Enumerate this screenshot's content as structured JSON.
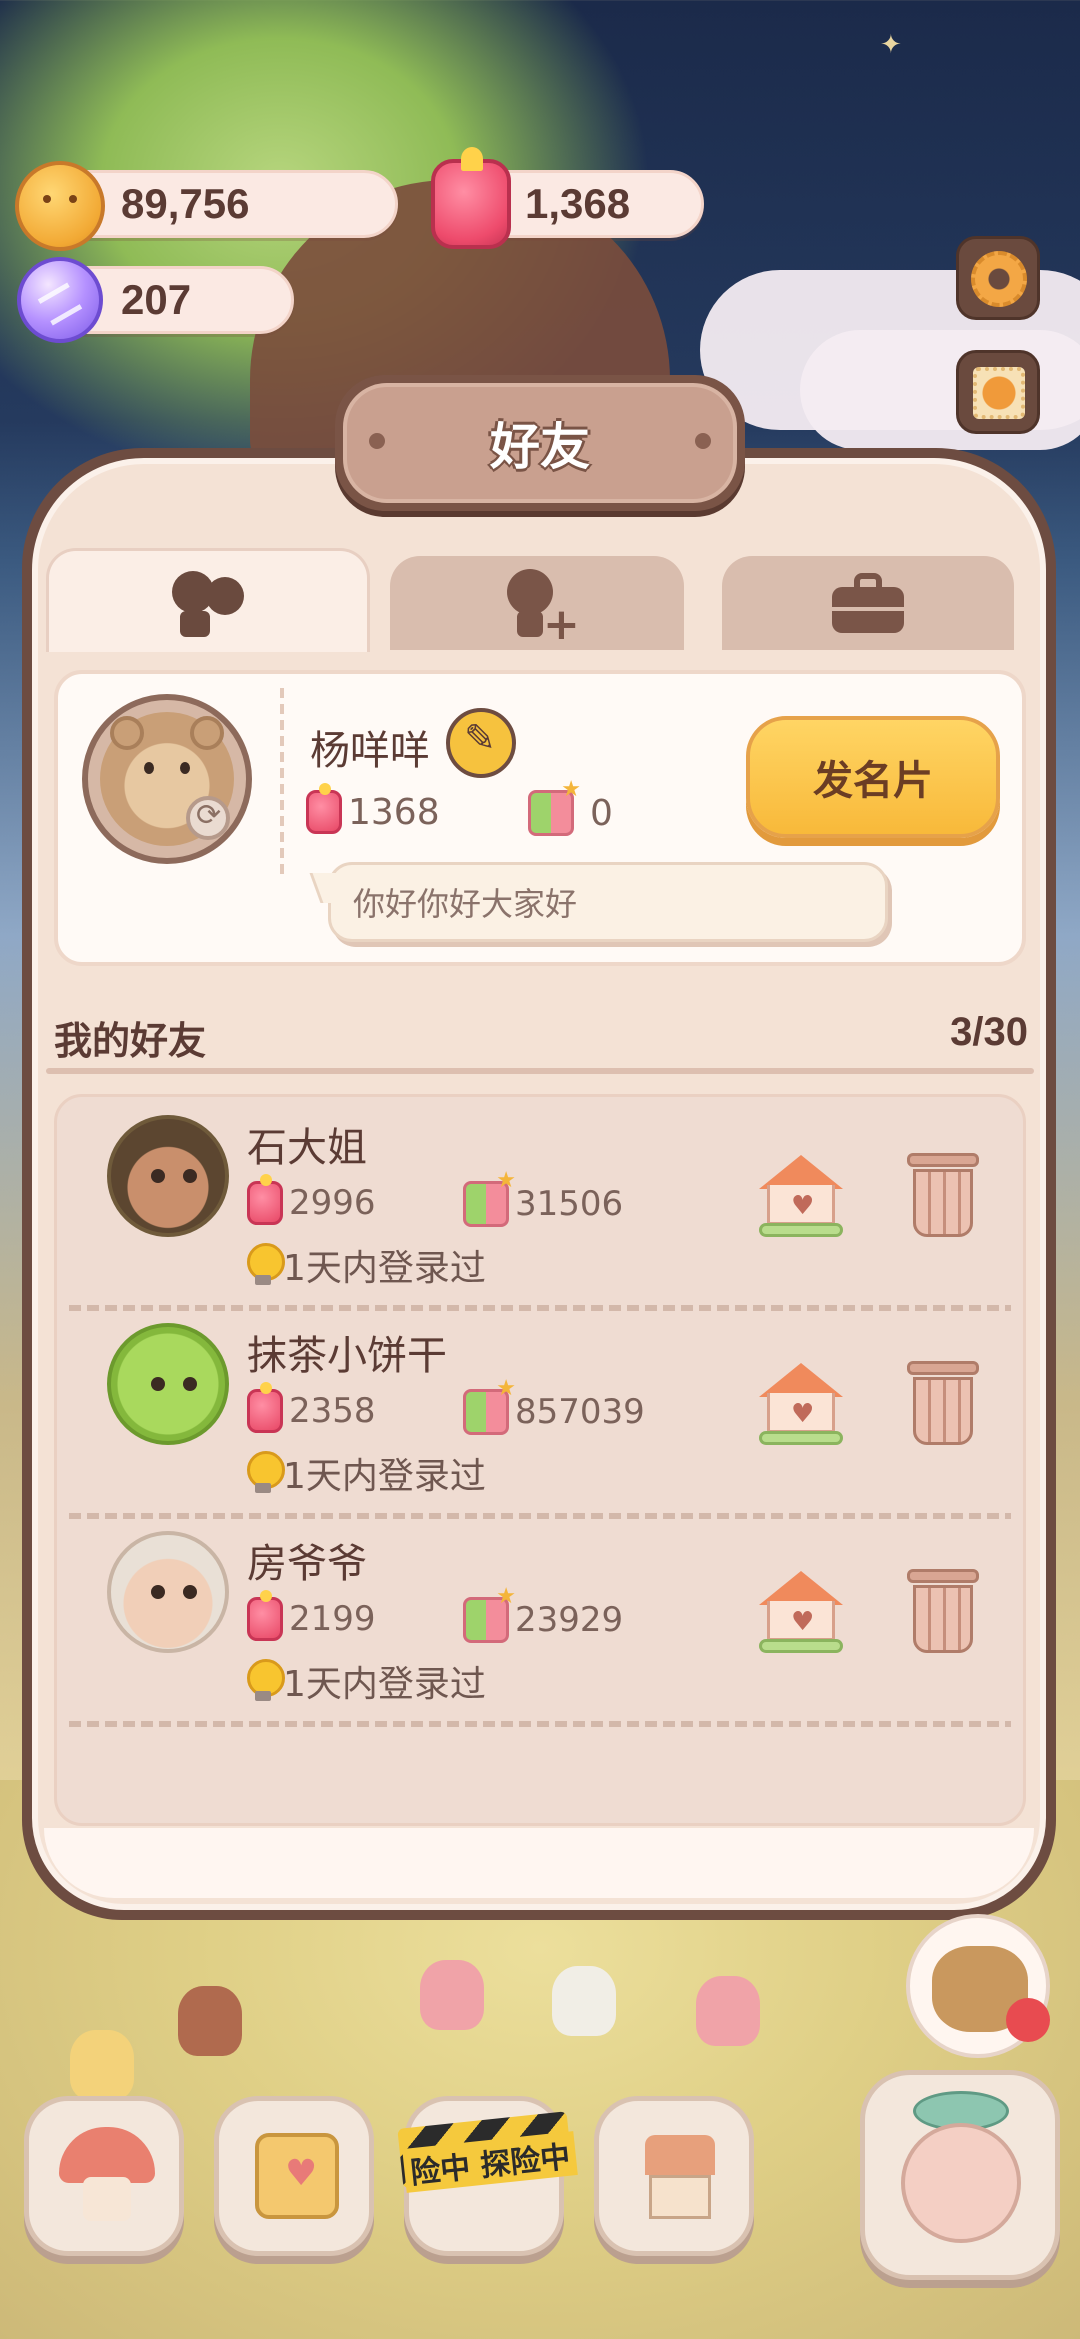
{
  "currency": {
    "coins": "89,756",
    "candy": "1,368",
    "gems": "207"
  },
  "dialog": {
    "title": "好友",
    "tabs": [
      {
        "icon": "friends-icon",
        "active": true
      },
      {
        "icon": "add-friend-icon",
        "active": false
      },
      {
        "icon": "briefcase-icon",
        "active": false
      }
    ]
  },
  "profile": {
    "name": "杨咩咩",
    "candy_count": "1368",
    "like_count": "0",
    "signature": "你好你好大家好",
    "send_card_label": "发名片"
  },
  "friends_section": {
    "title": "我的好友",
    "count": "3/30",
    "items": [
      {
        "name": "石大姐",
        "candy": "2996",
        "likes": "31506",
        "login": "1天内登录过"
      },
      {
        "name": "抹茶小饼干",
        "candy": "2358",
        "likes": "857039",
        "login": "1天内登录过"
      },
      {
        "name": "房爷爷",
        "candy": "2199",
        "likes": "23929",
        "login": "1天内登录过"
      }
    ]
  },
  "bottom_nav": {
    "adventure_label": "险中 探险中"
  },
  "colors": {
    "panel": "#f4e2d5",
    "frame": "#6d4c41",
    "button_yellow": "#f8b93a",
    "text_brown": "#5b3b34"
  }
}
